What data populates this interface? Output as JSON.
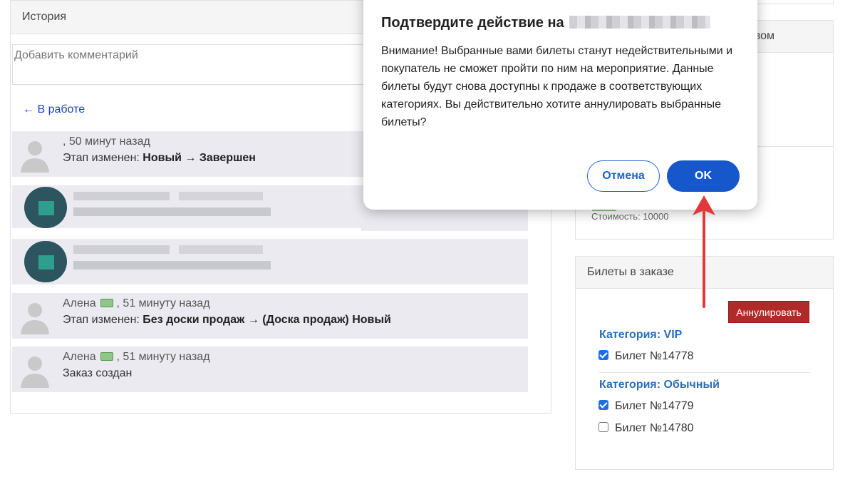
{
  "history": {
    "title": "История",
    "comment_placeholder": "Добавить комментарий",
    "back_link": "← В работе",
    "entries": [
      {
        "author": "",
        "time": ", 50 минут назад",
        "prefix": "Этап изменен: ",
        "detail": "Новый → Завершен"
      },
      {
        "author": "Алена",
        "time": " , 51 минуту назад",
        "prefix": "Этап изменен: ",
        "detail": "Без доски продаж → (Доска продаж) Новый"
      },
      {
        "author": "Алена",
        "time": " , 51 минуту назад",
        "text": "Заказ создан"
      }
    ]
  },
  "right": {
    "partial_label": "вом",
    "cost": "Стоимость: 10000",
    "tickets_panel_title": "Билеты в заказе",
    "annul_button": "Аннулировать",
    "categories": [
      {
        "label": "Категория: VIP",
        "tickets": [
          {
            "label": "Билет №14778",
            "checked": true
          }
        ]
      },
      {
        "label": "Категория: Обычный",
        "tickets": [
          {
            "label": "Билет №14779",
            "checked": true
          },
          {
            "label": "Билет №14780",
            "checked": false
          }
        ]
      }
    ]
  },
  "dialog": {
    "title": "Подтвердите действие на",
    "message": "Внимание! Выбранные вами билеты станут недействительными и покупатель не сможет пройти по ним на мероприятие. Данные билеты будут снова доступны к продаже в соответствующих категориях. Вы действительно хотите аннулировать выбранные билеты?",
    "cancel": "Отмена",
    "ok": "OK"
  },
  "colors": {
    "accent": "#1658cc",
    "danger": "#b02a2a",
    "arrow": "#e0393b",
    "category": "#2a6fb8"
  }
}
